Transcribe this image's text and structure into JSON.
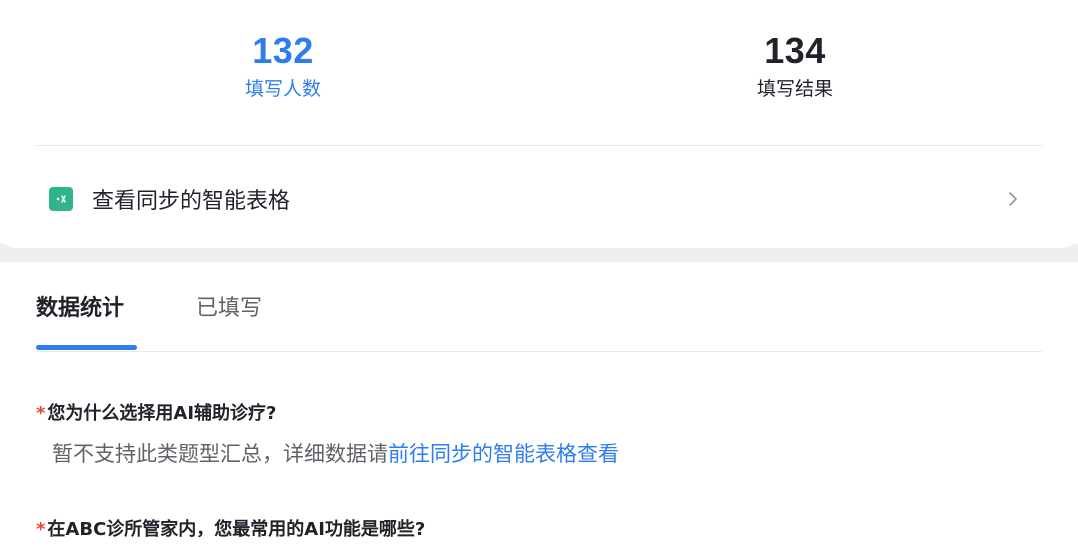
{
  "summary": {
    "respondents": {
      "value": "132",
      "label": "填写人数"
    },
    "results": {
      "value": "134",
      "label": "填写结果"
    }
  },
  "sync": {
    "label": "查看同步的智能表格",
    "icon": "smart-sheet-icon",
    "chevron": "chevron-right-icon"
  },
  "tabs": [
    {
      "label": "数据统计",
      "active": true
    },
    {
      "label": "已填写",
      "active": false
    }
  ],
  "questions": [
    {
      "required_mark": "*",
      "title": "您为什么选择用AI辅助诊疗?",
      "note_prefix": "暂不支持此类题型汇总，详细数据请",
      "note_link": "前往同步的智能表格查看"
    },
    {
      "required_mark": "*",
      "title": "在ABC诊所管家内，您最常用的AI功能是哪些?"
    }
  ],
  "colors": {
    "accent": "#2f7cf0",
    "required": "#e5483a",
    "sheet_icon": "#2fb58d"
  }
}
